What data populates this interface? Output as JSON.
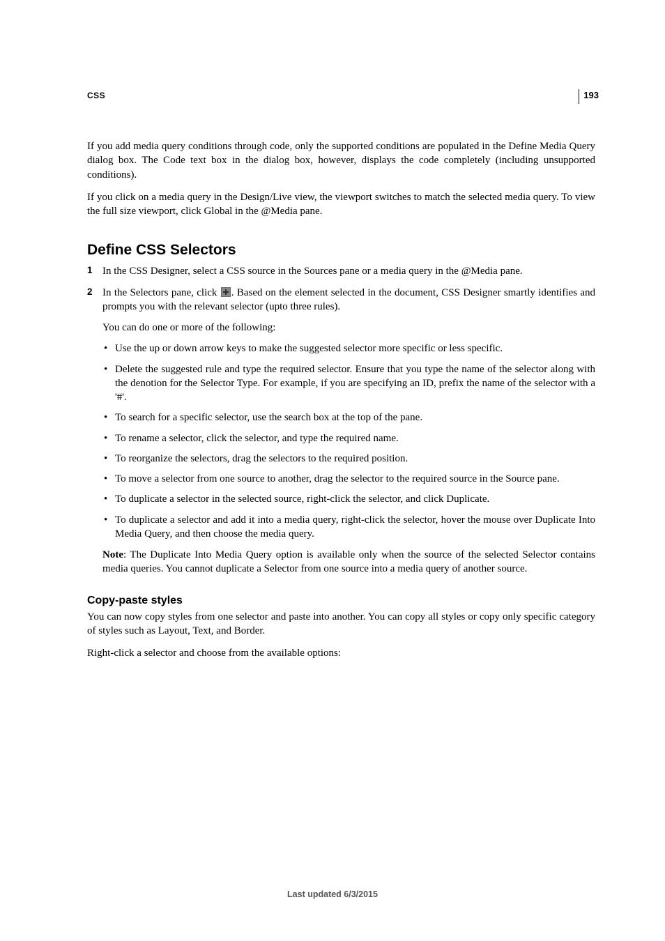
{
  "page": {
    "section_label": "CSS",
    "page_number": "193"
  },
  "intro": {
    "p1": "If you add media query conditions through code, only the supported conditions are populated in the Define Media Query dialog box. The Code text box in the dialog box, however, displays the code completely (including unsupported conditions).",
    "p2": "If you click on a media query in the Design/Live view, the viewport switches to match the selected media query. To view the full size viewport, click Global in the @Media pane."
  },
  "define": {
    "heading": "Define CSS Selectors",
    "steps": {
      "s1_num": "1",
      "s1_text": "In the CSS Designer, select a CSS source in the Sources pane or a media query in the @Media pane.",
      "s2_num": "2",
      "s2_before": "In the Selectors pane, click ",
      "s2_after": ". Based on the element selected in the document, CSS Designer smartly identifies and prompts you with the relevant selector (upto three rules).",
      "s2_follow": "You can do one or more of the following:"
    },
    "bullets": {
      "b1": "Use the up or down arrow keys to make the suggested selector more specific or less specific.",
      "b2": "Delete the suggested rule and type the required selector. Ensure that you type the name of the selector along with the denotion for the Selector Type. For example, if you are specifying an ID, prefix the name of the selector with a '#'.",
      "b3": "To search for a specific selector, use the search box at the top of the pane.",
      "b4": "To rename a selector, click the selector, and type the required name.",
      "b5": "To reorganize the selectors, drag the selectors to the required position.",
      "b6": "To move a selector from one source to another, drag the selector to the required source in the Source pane.",
      "b7": "To duplicate a selector in the selected source, right-click the selector, and click Duplicate.",
      "b8": "To duplicate a selector and add it into a media query, right-click the selector, hover the mouse over Duplicate Into Media Query, and then choose the media query."
    },
    "note_label": "Note",
    "note_text": ": The Duplicate Into Media Query option is available only when the source of the selected Selector contains media queries. You cannot duplicate a Selector from one source into a media query of another source."
  },
  "copy": {
    "heading": "Copy-paste styles",
    "p1": "You can now copy styles from one selector and paste into another. You can copy all styles or copy only specific category of styles such as Layout, Text, and Border.",
    "p2": "Right-click a selector and choose from the available options:"
  },
  "footer": {
    "text": "Last updated 6/3/2015"
  }
}
